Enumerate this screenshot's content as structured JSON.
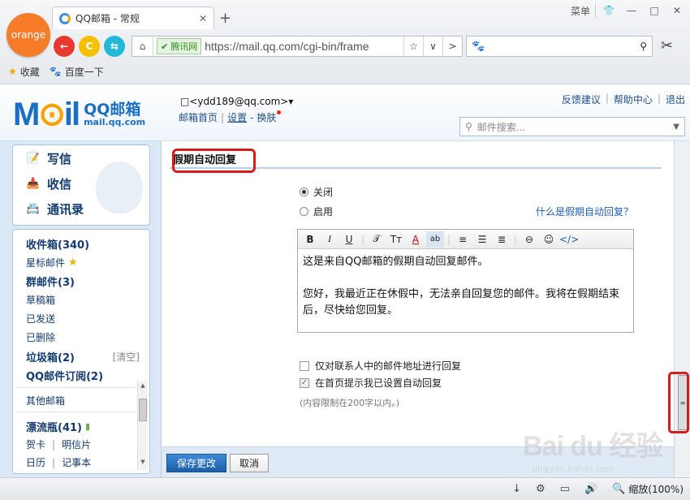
{
  "browser": {
    "logo": "orange",
    "tab_title": "QQ邮箱 - 常规",
    "tab_close": "✕",
    "new_tab": "+",
    "menu_label": "菜单",
    "window_controls": [
      "👕",
      "—",
      "□",
      "✕"
    ],
    "back": "←",
    "refresh": "C",
    "forward_alt": "⇆",
    "home": "⌂",
    "secure_badge": "腾讯网",
    "url": "https://mail.qq.com/cgi-bin/frame",
    "star": "☆",
    "dropdown": "∨",
    "next": ">",
    "search_icon": "⚲",
    "scissors": "✂",
    "bookmarks": [
      {
        "icon": "★",
        "label": "收藏"
      },
      {
        "icon": "🐾",
        "label": "百度一下"
      }
    ]
  },
  "header": {
    "brand_mail": "M",
    "brand_o": "⊙",
    "brand_il": "il",
    "brand_cn": "QQ邮箱",
    "brand_domain": "mail.qq.com",
    "user_email": "□<ydd189@qq.com>▾",
    "links": {
      "home": "邮箱首页",
      "settings": "设置",
      "skin": "换肤"
    },
    "top_links": [
      "反馈建议",
      "帮助中心",
      "退出"
    ],
    "search_placeholder": "邮件搜索..."
  },
  "sidebar": {
    "quick": [
      {
        "icon": "📝",
        "label": "写信"
      },
      {
        "icon": "📥",
        "label": "收信"
      },
      {
        "icon": "📇",
        "label": "通讯录"
      }
    ],
    "folders": {
      "inbox": "收件箱(340)",
      "starred": "星标邮件",
      "starred_icon": "★",
      "group": "群邮件(3)",
      "drafts": "草稿箱",
      "sent": "已发送",
      "deleted": "已删除",
      "spam": "垃圾箱(2)",
      "clear": "[清空]",
      "subscriptions": "QQ邮件订阅(2)",
      "other": "其他邮箱",
      "drift": "漂流瓶(41)",
      "cards": "贺卡",
      "postcards": "明信片",
      "calendar": "日历",
      "notes": "记事本",
      "sep": "|"
    }
  },
  "main": {
    "title": "假期自动回复",
    "radio_off": "关闭",
    "radio_on": "启用",
    "what_link": "什么是假期自动回复？",
    "toolbar": [
      "B",
      "I",
      "U",
      "|",
      "𝒯",
      "Tт",
      "A",
      "ab",
      "|",
      "≡",
      "☰",
      "≣",
      "|",
      "⊖",
      "☺",
      "</>"
    ],
    "editor_lines": [
      "这是来自QQ邮箱的假期自动回复邮件。",
      "",
      "您好，我最近正在休假中，无法亲自回复您的邮件。我将在假期结束后，尽快给您回复。"
    ],
    "check_contacts": "仅对联系人中的邮件地址进行回复",
    "check_homepage": "在首页提示我已设置自动回复",
    "limit_note": "(内容限制在200字以内。)",
    "save_button": "保存更改",
    "cancel_button": "取消"
  },
  "statusbar": {
    "icons": [
      "↓",
      "⚙",
      "▭",
      "🔊",
      "🔍"
    ],
    "zoom": "缩放(100%)"
  },
  "watermark": {
    "logo": "Bai du 经验",
    "sub": "jingyan.baidu.com"
  }
}
